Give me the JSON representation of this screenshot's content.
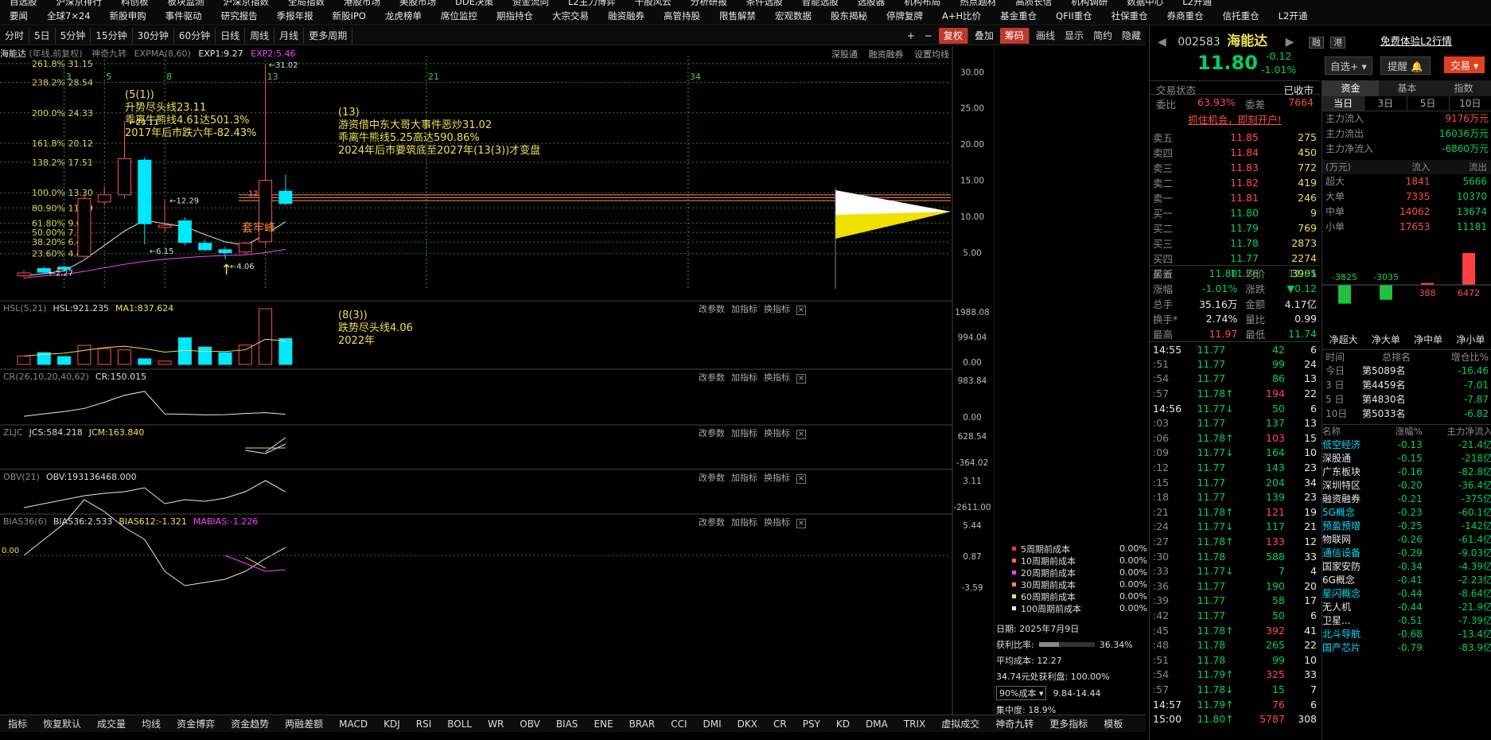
{
  "topnav": {
    "row1": [
      "自选股",
      "沪深京排行",
      "科创板",
      "板块监测",
      "沪深京指数",
      "全局指数",
      "港股市场",
      "美股市场",
      "DDE决策",
      "资金流向",
      "L2主力博弈",
      "千股风云",
      "分析研报",
      "条件选股",
      "智能选股",
      "选股器",
      "机构布局",
      "热点题材",
      "高质长信",
      "机构调研",
      "数据中心",
      "L2开通"
    ],
    "row2": [
      "要闻",
      "全球7×24",
      "新股申购",
      "事件驱动",
      "研究报告",
      "季报年报",
      "新股IPO",
      "龙虎榜单",
      "席位监控",
      "期指持仓",
      "大宗交易",
      "融资融券",
      "高管持股",
      "限售解禁",
      "宏观数据",
      "股东揭秘",
      "停牌复牌",
      "A+H比价",
      "基金重仓",
      "QFII重仓",
      "社保重仓",
      "券商重仓",
      "信托重仓",
      "L2开通"
    ]
  },
  "toolbar": {
    "left": [
      "分时",
      "5日",
      "5分钟",
      "15分钟",
      "30分钟",
      "60分钟",
      "日线",
      "周线",
      "月线",
      "更多周期"
    ],
    "active": "年线",
    "right": [
      "+",
      "−",
      "复权",
      "叠加",
      "筹码",
      "画线",
      "显示",
      "简约",
      "隐藏"
    ]
  },
  "main_chart": {
    "title": "海能达",
    "subtitle": "(年线,前复权)",
    "indicator": "神奇九转",
    "expma": "EXPMA(8,60)",
    "exp1": "EXP1:9.27",
    "exp2": "EXP2:5.46",
    "links": [
      "深股通",
      "融资融券",
      "设置均线"
    ],
    "fib": [
      "261.8% 31.15",
      "238.2% 28.54",
      "200.0% 24.33",
      "161.8% 20.12",
      "138.2% 17.51",
      "100.0% 13.30",
      "80.90% 11.19",
      "61.80% 9.09",
      "50.00% 7.79",
      "38.20% 6.48",
      "23.60% 4.87"
    ],
    "ann1": [
      "(5(1))",
      "升势尽头线23.11",
      "乖离牛熊线4.61达501.3%",
      "2017年后市跌六年-82.43%"
    ],
    "ann2": [
      "(13)",
      "游资借中东大哥大事件恶炒31.02",
      "乖离牛熊线5.25高达590.86%",
      "2024年后市要筑底至2027年(13(3))才变盘"
    ],
    "ann3": [
      "(8(3))",
      "跌势尽头线4.06",
      "2022年"
    ],
    "taoloafeng": "套牢峰",
    "price1261": "12.61",
    "p1229": "12.29",
    "p3102": "31.02",
    "p2311": "23.11",
    "p615": "6.15",
    "p406": "4.06",
    "p227": "2.27",
    "fib_nums": [
      "3",
      "5",
      "8",
      "13",
      "21",
      "34"
    ],
    "yticks": [
      "30.00",
      "25.00",
      "20.00",
      "15.00",
      "10.00",
      "5.00"
    ]
  },
  "candles": [
    {
      "o": 1.8,
      "c": 2.2,
      "h": 2.6,
      "l": 1.6
    },
    {
      "o": 2.8,
      "c": 2.3,
      "h": 3.1,
      "l": 2.0
    },
    {
      "o": 3.0,
      "c": 2.7,
      "h": 3.2,
      "l": 2.5
    },
    {
      "o": 4.5,
      "c": 12.5,
      "h": 13.2,
      "l": 4.2
    },
    {
      "o": 12.0,
      "c": 13.0,
      "h": 14.2,
      "l": 11.5
    },
    {
      "o": 13.0,
      "c": 18.0,
      "h": 23.11,
      "l": 12.5
    },
    {
      "o": 17.8,
      "c": 9.0,
      "h": 18.2,
      "l": 6.15
    },
    {
      "o": 8.5,
      "c": 8.8,
      "h": 12.29,
      "l": 7.9
    },
    {
      "o": 9.4,
      "c": 6.4,
      "h": 9.9,
      "l": 6.0
    },
    {
      "o": 6.3,
      "c": 5.4,
      "h": 6.8,
      "l": 5.2
    },
    {
      "o": 5.4,
      "c": 5.0,
      "h": 5.8,
      "l": 4.06
    },
    {
      "o": 5.1,
      "c": 6.3,
      "h": 6.5,
      "l": 4.8
    },
    {
      "o": 6.5,
      "c": 15.0,
      "h": 31.02,
      "l": 6.0
    },
    {
      "o": 13.5,
      "c": 11.8,
      "h": 15.8,
      "l": 11.5
    }
  ],
  "sub": {
    "hsl": {
      "title": "HSL(5,21)",
      "v1": "HSL:921.235",
      "v2": "MA1:837.624",
      "ticks": [
        "1988.08",
        "994.04",
        "0.00"
      ],
      "vals": [
        300,
        420,
        280,
        680,
        560,
        520,
        200,
        120,
        950,
        620,
        420,
        690,
        1988,
        921
      ]
    },
    "cr": {
      "title": "CR(26,10,20,40,62)",
      "v1": "CR:150.015",
      "ticks": [
        "983.84",
        "0.00"
      ],
      "vals": [
        60,
        120,
        180,
        260,
        420,
        600,
        700,
        120,
        110,
        95,
        100,
        130,
        150,
        110
      ]
    },
    "zljc": {
      "title": "ZLJC",
      "v1": "JCS:584.218",
      "v2": "JCM:163.840",
      "ticks": [
        "628.54",
        "-364.02"
      ]
    },
    "obv": {
      "title": "OBV(21)",
      "v1": "OBV:193136468.000",
      "ticks": [
        "3.11",
        "-2611.00"
      ]
    },
    "bias": {
      "title": "BIAS36(6)",
      "v1": "BIAS36:2.533",
      "v2": "BIAS612:-1.321",
      "v3": "MABIAS:-1.226",
      "ticks": [
        "5.44",
        "0.87",
        "-3.59"
      ],
      "zero": "0.00"
    }
  },
  "panel_btns": [
    "改参数",
    "加指标",
    "换指标"
  ],
  "cost": {
    "items": [
      "5周期前成本",
      "10周期前成本",
      "20周期前成本",
      "30周期前成本",
      "60周期前成本",
      "100周期前成本"
    ],
    "vals": [
      "0.00%",
      "0.00%",
      "0.00%",
      "0.00%",
      "0.00%",
      "0.00%"
    ],
    "colors": [
      "#ff3030",
      "#ff6060",
      "#ff40ff",
      "#ff8c40",
      "#f0e050",
      "#e8e8e8"
    ],
    "date": "日期: 2025年7月9日",
    "profit_label": "获利比率:",
    "profit": "36.34%",
    "avg": "平均成本: 12.27",
    "profit2": "34.74元处获利盘: 100.00%",
    "cost90": "90%成本",
    "range": "9.84-14.44",
    "focus": "集中度: 18.9%"
  },
  "bottombar": [
    "指标",
    "恢复默认",
    "成交量",
    "均线",
    "资金博弈",
    "资金趋势",
    "两融差额",
    "MACD",
    "KDJ",
    "RSI",
    "BOLL",
    "WR",
    "OBV",
    "BIAS",
    "ENE",
    "BRAR",
    "CCI",
    "DMI",
    "DKX",
    "CR",
    "PSY",
    "KD",
    "DMA",
    "TRIX",
    "虚拟成交",
    "神奇九转",
    "更多指标",
    "模板"
  ],
  "stock": {
    "code": "002583",
    "name": "海能达",
    "price": "11.80",
    "chg": "-0.12",
    "pct": "-1.01%",
    "tags": [
      "融",
      "港"
    ],
    "promo": "免费体验L2行情",
    "btns": [
      "自选+",
      "提醒",
      "交易"
    ],
    "status_label": "交易状态",
    "status": "已收市",
    "weibi_label": "委比",
    "weibi": "63.93%",
    "weicha_label": "委差",
    "weicha": "7664",
    "open_link": "抓住机会，即刻开户!"
  },
  "orderbook": {
    "sell": [
      [
        "卖五",
        "11.85",
        "275"
      ],
      [
        "卖四",
        "11.84",
        "450"
      ],
      [
        "卖三",
        "11.83",
        "772"
      ],
      [
        "卖二",
        "11.82",
        "419"
      ],
      [
        "卖一",
        "11.81",
        "246"
      ]
    ],
    "buy": [
      [
        "买一",
        "11.80",
        "9"
      ],
      [
        "买二",
        "11.79",
        "769"
      ],
      [
        "买三",
        "11.78",
        "2873"
      ],
      [
        "买四",
        "11.77",
        "2274"
      ],
      [
        "买五",
        "11.76",
        "3901"
      ]
    ]
  },
  "stats": [
    [
      "最新",
      "11.80",
      "均价",
      "11.85"
    ],
    [
      "涨幅",
      "-1.01%",
      "涨跌",
      "▼0.12"
    ],
    [
      "总手",
      "35.16万",
      "金额",
      "4.17亿"
    ],
    [
      "换手*",
      "2.74%",
      "量比",
      "0.99"
    ],
    [
      "最高",
      "11.97",
      "最低",
      "11.74"
    ]
  ],
  "ticks": [
    [
      "14:55",
      "11.77",
      "42",
      "6"
    ],
    [
      ":51",
      "11.77",
      "99",
      "24"
    ],
    [
      ":54",
      "11.77",
      "86",
      "13"
    ],
    [
      ":57",
      "11.78↑",
      "194",
      "22"
    ],
    [
      "14:56",
      "11.77↓",
      "50",
      "6"
    ],
    [
      ":03",
      "11.77",
      "137",
      "13"
    ],
    [
      ":06",
      "11.78↑",
      "103",
      "15"
    ],
    [
      ":09",
      "11.77↓",
      "164",
      "10"
    ],
    [
      ":12",
      "11.77",
      "143",
      "23"
    ],
    [
      ":15",
      "11.77",
      "204",
      "34"
    ],
    [
      ":18",
      "11.77",
      "139",
      "23"
    ],
    [
      ":21",
      "11.78↑",
      "121",
      "19"
    ],
    [
      ":24",
      "11.77↓",
      "117",
      "21"
    ],
    [
      ":27",
      "11.78↑",
      "133",
      "12"
    ],
    [
      ":30",
      "11.78",
      "588",
      "33"
    ],
    [
      ":33",
      "11.77↓",
      "7",
      "4"
    ],
    [
      ":36",
      "11.77",
      "190",
      "20"
    ],
    [
      ":39",
      "11.77",
      "58",
      "17"
    ],
    [
      ":42",
      "11.77",
      "50",
      "6"
    ],
    [
      ":45",
      "11.78↑",
      "392",
      "41"
    ],
    [
      ":48",
      "11.78",
      "265",
      "22"
    ],
    [
      ":51",
      "11.78",
      "99",
      "10"
    ],
    [
      ":54",
      "11.79↑",
      "325",
      "33"
    ],
    [
      ":57",
      "11.78↓",
      "15",
      "7"
    ],
    [
      "14:57",
      "11.79↑",
      "76",
      "6"
    ],
    [
      "15:00",
      "11.80↑",
      "5787",
      "308"
    ]
  ],
  "fund": {
    "tabs": [
      "资金",
      "基本",
      "指数"
    ],
    "subtabs": [
      "当日",
      "3日",
      "5日",
      "10日"
    ],
    "main": [
      [
        "主力流入",
        "9176万元"
      ],
      [
        "主力流出",
        "16036万元"
      ],
      [
        "主力净流入",
        "-6860万元"
      ]
    ],
    "head": [
      "(万元)",
      "流入",
      "流出"
    ],
    "rows": [
      [
        "超大",
        "1841",
        "5666"
      ],
      [
        "大单",
        "7335",
        "10370"
      ],
      [
        "中单",
        "14062",
        "13674"
      ],
      [
        "小单",
        "17653",
        "11181"
      ]
    ],
    "bars": [
      {
        "label": "-3825",
        "v": -3825
      },
      {
        "label": "-3035",
        "v": -3035
      },
      {
        "label": "388",
        "v": 388
      },
      {
        "label": "6472",
        "v": 6472
      }
    ],
    "bar_labels": [
      "净超大",
      "净大单",
      "净中单",
      "净小单"
    ],
    "rank_head": [
      "时间",
      "总排名",
      "增仓比%"
    ],
    "ranks": [
      [
        "今日",
        "第5089名",
        "-16.46"
      ],
      [
        "3 日",
        "第4459名",
        "-7.01"
      ],
      [
        "5 日",
        "第4830名",
        "-7.87"
      ],
      [
        "10日",
        "第5033名",
        "-6.82"
      ]
    ],
    "sect_head": [
      "名称",
      "涨幅%",
      "主力净流入"
    ],
    "sectors": [
      [
        "低空经济",
        "-0.13",
        "-21.4亿",
        "c"
      ],
      [
        "深股通",
        "-0.15",
        "-218亿",
        "w"
      ],
      [
        "广东板块",
        "-0.16",
        "-82.8亿",
        "w"
      ],
      [
        "深圳特区",
        "-0.20",
        "-36.4亿",
        "w"
      ],
      [
        "融资融券",
        "-0.21",
        "-375亿",
        "w"
      ],
      [
        "5G概念",
        "-0.23",
        "-60.1亿",
        "c"
      ],
      [
        "预盈预增",
        "-0.25",
        "-142亿",
        "c"
      ],
      [
        "物联网",
        "-0.26",
        "-61.4亿",
        "w"
      ],
      [
        "通信设备",
        "-0.29",
        "-9.03亿",
        "c"
      ],
      [
        "国家安防",
        "-0.34",
        "-4.39亿",
        "w"
      ],
      [
        "6G概念",
        "-0.41",
        "-2.23亿",
        "w"
      ],
      [
        "星闪概念",
        "-0.44",
        "-8.64亿",
        "c"
      ],
      [
        "无人机",
        "-0.44",
        "-21.9亿",
        "w"
      ],
      [
        "卫星...",
        "-0.51",
        "-7.39亿",
        "w"
      ],
      [
        "北斗导航",
        "-0.68",
        "-13.4亿",
        "c"
      ],
      [
        "国产芯片",
        "-0.79",
        "-83.9亿",
        "c"
      ]
    ]
  }
}
